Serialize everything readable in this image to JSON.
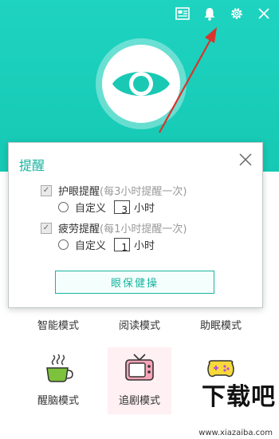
{
  "colors": {
    "accent": "#19b39f",
    "header_bg": "#18cdb9",
    "arrow": "#d9342b"
  },
  "header": {
    "icons": [
      "news-icon",
      "bell-icon",
      "gear-icon",
      "close-icon"
    ]
  },
  "dialog": {
    "title": "提醒",
    "eye_reminder": {
      "label": "护眼提醒",
      "note": "(每3小时提醒一次)",
      "custom_label": "自定义",
      "value": "3",
      "unit": "小时"
    },
    "fatigue_reminder": {
      "label": "疲劳提醒",
      "note": "(每1小时提醒一次)",
      "custom_label": "自定义",
      "value": "1",
      "unit": "小时"
    },
    "button_label": "眼保健操"
  },
  "modes": {
    "row1": [
      "智能模式",
      "阅读模式",
      "助眠模式"
    ],
    "row2": [
      "醒脑模式",
      "追剧模式",
      ""
    ]
  },
  "watermark": {
    "brand": "下载吧",
    "url": "www.xiazaiba.com"
  }
}
